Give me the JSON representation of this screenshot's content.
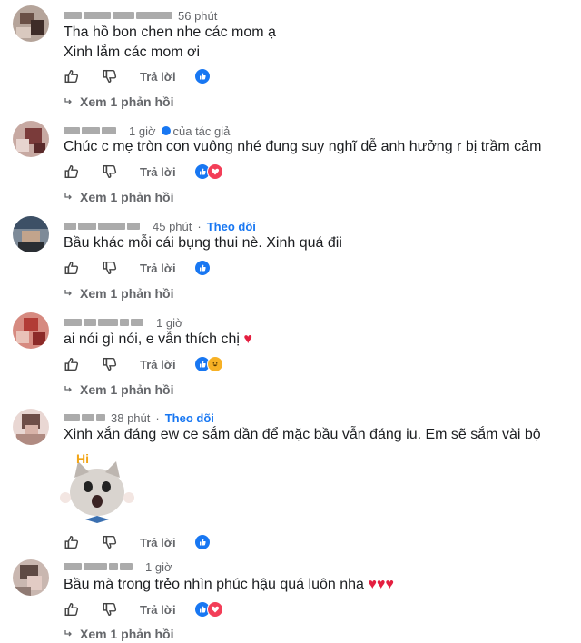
{
  "comments": [
    {
      "time": "56 phút",
      "lines": [
        "Tha hồ bon chen nhe các mom ạ",
        "Xinh lắm các mom ơi"
      ],
      "reply_label": "Trả lời",
      "view_replies": "Xem 1 phản hồi",
      "reactions": [
        "like"
      ]
    },
    {
      "time": "1 giờ",
      "badge": "của tác giả",
      "lines": [
        "Chúc c mẹ tròn con vuông nhé đung suy nghĩ dễ anh hưởng r bị trầm cảm"
      ],
      "reply_label": "Trả lời",
      "view_replies": "Xem 1 phản hồi",
      "reactions": [
        "like",
        "love"
      ]
    },
    {
      "time": "45 phút",
      "follow": "Theo dõi",
      "lines": [
        "Bầu khác mỗi cái bụng thui nè. Xinh quá đii"
      ],
      "reply_label": "Trả lời",
      "view_replies": "Xem 1 phản hồi",
      "reactions": [
        "like"
      ]
    },
    {
      "time": "1 giờ",
      "lines": [
        "ai nói gì nói, e vẫn thích chị"
      ],
      "heart_suffix": "♥",
      "reply_label": "Trả lời",
      "view_replies": "Xem 1 phản hồi",
      "reactions": [
        "like",
        "haha"
      ]
    },
    {
      "time": "38 phút",
      "follow": "Theo dõi",
      "lines": [
        "Xinh xắn đáng ew ce sắm dần để mặc bầu vẫn đáng iu. Em sẽ sắm vài bộ"
      ],
      "sticker_text": "Hi",
      "reply_label": "Trả lời",
      "reactions": [
        "like"
      ]
    },
    {
      "time": "1 giờ",
      "lines": [
        "Bầu mà trong trẻo nhìn phúc hậu quá luôn nha"
      ],
      "heart_suffix": "♥♥♥",
      "reply_label": "Trả lời",
      "view_replies": "Xem 1 phản hồi",
      "reactions": [
        "like",
        "love"
      ]
    }
  ],
  "colors": {
    "accent": "#1877f2",
    "love": "#f33e58",
    "heart": "#e41e3f"
  }
}
